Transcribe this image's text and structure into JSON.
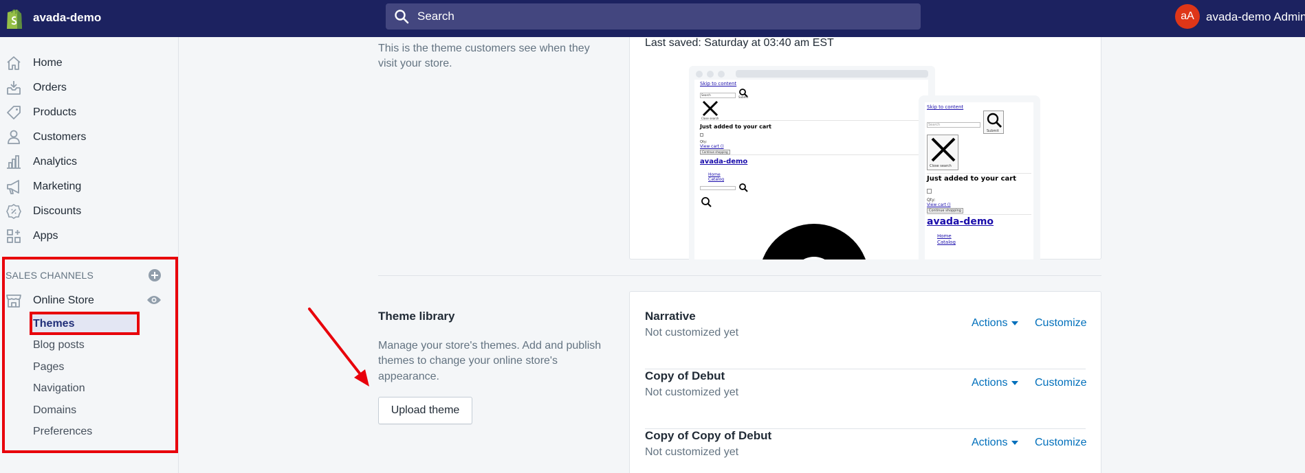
{
  "topbar": {
    "store_name": "avada-demo",
    "search_placeholder": "Search",
    "avatar_initials": "aA",
    "admin_name": "avada-demo Admin"
  },
  "sidebar": {
    "items": [
      {
        "label": "Home",
        "icon": "home-icon"
      },
      {
        "label": "Orders",
        "icon": "orders-icon"
      },
      {
        "label": "Products",
        "icon": "tag-icon"
      },
      {
        "label": "Customers",
        "icon": "person-icon"
      },
      {
        "label": "Analytics",
        "icon": "bar-chart-icon"
      },
      {
        "label": "Marketing",
        "icon": "megaphone-icon"
      },
      {
        "label": "Discounts",
        "icon": "discount-icon"
      },
      {
        "label": "Apps",
        "icon": "apps-icon"
      }
    ],
    "sales_channels_title": "SALES CHANNELS",
    "online_store_label": "Online Store",
    "sub_items": [
      "Themes",
      "Blog posts",
      "Pages",
      "Navigation",
      "Domains",
      "Preferences"
    ]
  },
  "current_theme": {
    "description_line1": "This is the theme customers see when they",
    "description_line2": "visit your store.",
    "last_saved": "Last saved: Saturday at 03:40 am EST"
  },
  "preview": {
    "skip_link": "Skip to content",
    "search_label": "Search",
    "submit_label": "Submit",
    "close_search": "Close search",
    "just_added": "Just added to your cart",
    "qty": "Qty:",
    "view_cart": "View cart ()",
    "continue_shopping": "Continue shopping",
    "brand": "avada-demo",
    "menu_home": "Home",
    "menu_catalog": "Catalog"
  },
  "theme_library": {
    "title": "Theme library",
    "description_line1": "Manage your store's themes. Add and publish",
    "description_line2": "themes to change your online store's",
    "description_line3": "appearance.",
    "upload_button": "Upload theme",
    "actions_label": "Actions",
    "customize_label": "Customize",
    "themes": [
      {
        "name": "Narrative",
        "status": "Not customized yet"
      },
      {
        "name": "Copy of Debut",
        "status": "Not customized yet"
      },
      {
        "name": "Copy of Copy of Debut",
        "status": "Not customized yet"
      }
    ]
  },
  "colors": {
    "topbar": "#1c2260",
    "link": "#006fbb",
    "annotation_red": "#e8000b",
    "avatar": "#de3618"
  }
}
